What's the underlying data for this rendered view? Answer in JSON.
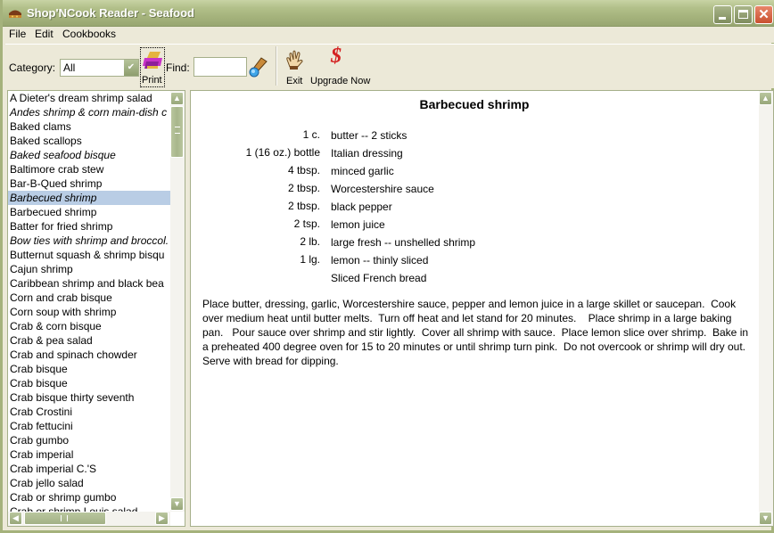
{
  "window": {
    "title": "Shop'NCook Reader - Seafood",
    "controls": {
      "minimize": "minimize",
      "maximize": "maximize",
      "close": "close"
    }
  },
  "menu": [
    "File",
    "Edit",
    "Cookbooks"
  ],
  "toolbar": {
    "category_label": "Category:",
    "category_value": "All",
    "print_label": "Print",
    "find_label": "Find:",
    "find_value": "",
    "exit_label": "Exit",
    "upgrade_label": "Upgrade Now",
    "icons": {
      "print": "printer-icon",
      "find": "flashlight-icon",
      "exit": "waving-hand-icon",
      "upgrade": "dollar-sign-icon"
    }
  },
  "recipe_list": {
    "selected_index": 7,
    "items": [
      {
        "label": "A Dieter's dream shrimp salad",
        "italic": false
      },
      {
        "label": "Andes shrimp & corn main-dish c",
        "italic": true
      },
      {
        "label": "Baked clams",
        "italic": false
      },
      {
        "label": "Baked scallops",
        "italic": false
      },
      {
        "label": "Baked seafood bisque",
        "italic": true
      },
      {
        "label": "Baltimore crab stew",
        "italic": false
      },
      {
        "label": "Bar-B-Qued shrimp",
        "italic": false
      },
      {
        "label": "Barbecued shrimp",
        "italic": true
      },
      {
        "label": "Barbecued shrimp",
        "italic": false
      },
      {
        "label": "Batter for fried shrimp",
        "italic": false
      },
      {
        "label": "Bow ties with shrimp and broccol.",
        "italic": true
      },
      {
        "label": "Butternut squash & shrimp bisqu",
        "italic": false
      },
      {
        "label": "Cajun shrimp",
        "italic": false
      },
      {
        "label": "Caribbean shrimp and black bea",
        "italic": false
      },
      {
        "label": "Corn and crab bisque",
        "italic": false
      },
      {
        "label": "Corn soup with shrimp",
        "italic": false
      },
      {
        "label": "Crab & corn bisque",
        "italic": false
      },
      {
        "label": "Crab & pea salad",
        "italic": false
      },
      {
        "label": "Crab and spinach chowder",
        "italic": false
      },
      {
        "label": "Crab bisque",
        "italic": false
      },
      {
        "label": "Crab bisque",
        "italic": false
      },
      {
        "label": "Crab bisque thirty seventh",
        "italic": false
      },
      {
        "label": "Crab Crostini",
        "italic": false
      },
      {
        "label": "Crab fettucini",
        "italic": false
      },
      {
        "label": "Crab gumbo",
        "italic": false
      },
      {
        "label": "Crab imperial",
        "italic": false
      },
      {
        "label": "Crab imperial C.'S",
        "italic": false
      },
      {
        "label": "Crab jello salad",
        "italic": false
      },
      {
        "label": "Crab or shrimp gumbo",
        "italic": false
      },
      {
        "label": "Crab or shrimp Louis salad",
        "italic": false
      }
    ]
  },
  "recipe": {
    "title": "Barbecued shrimp",
    "ingredients": [
      {
        "qty": "1 c.",
        "name": "butter -- 2 sticks"
      },
      {
        "qty": "1 (16 oz.) bottle",
        "name": "Italian dressing"
      },
      {
        "qty": "4 tbsp.",
        "name": "minced garlic"
      },
      {
        "qty": "2 tbsp.",
        "name": "Worcestershire sauce"
      },
      {
        "qty": "2 tbsp.",
        "name": "black pepper"
      },
      {
        "qty": "2 tsp.",
        "name": "lemon  juice"
      },
      {
        "qty": "2 lb.",
        "name": "large fresh -- unshelled shrimp"
      },
      {
        "qty": "1 lg.",
        "name": "lemon -- thinly sliced"
      },
      {
        "qty": "",
        "name": "Sliced French bread"
      }
    ],
    "directions": "Place butter, dressing, garlic, Worcestershire sauce, pepper and lemon juice in a large skillet or saucepan.  Cook over medium heat until butter melts.  Turn off heat and let stand for 20 minutes.    Place shrimp in a large baking pan.   Pour sauce over shrimp and stir lightly.  Cover all shrimp with sauce.  Place lemon slice over shrimp.  Bake in a preheated 400 degree oven for 15 to 20 minutes or until shrimp turn pink.  Do not overcook or shrimp will dry out.  Serve with bread for dipping."
  },
  "colors": {
    "titlebar": "#A3B17A",
    "selection": "#B9CDE5",
    "scrollbar": "#A8B68B",
    "upgrade_icon": "#D42020"
  }
}
